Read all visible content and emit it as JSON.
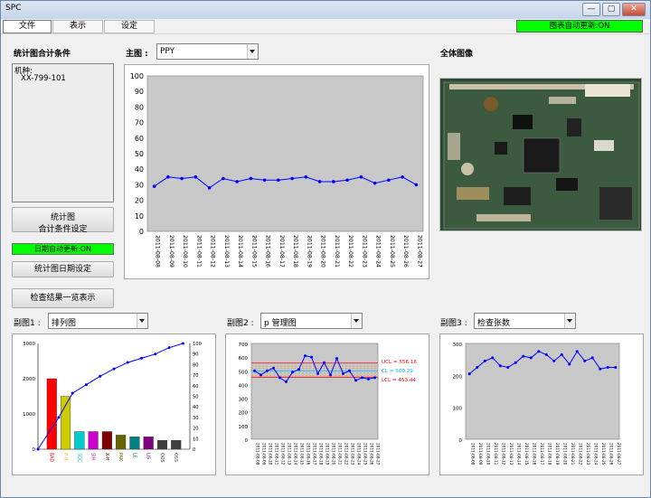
{
  "window": {
    "title": "SPC",
    "minimize": "—",
    "maximize": "▢",
    "close": "✕"
  },
  "menu": {
    "items": [
      "文件",
      "表示",
      "设定"
    ]
  },
  "auto_update_badge": "图表自动更新:ON",
  "left": {
    "section_title": "统计图合计条件",
    "conditions": [
      "机种:",
      "XX-799-101"
    ],
    "btn_stat_line1": "统计图",
    "btn_stat_line2": "合计条件设定",
    "date_auto": "日期自动更新:ON",
    "btn_date": "统计图日期设定",
    "btn_list": "检查结果一览表示"
  },
  "main_chart": {
    "label": "主图 :",
    "select_value": "PPY"
  },
  "overview_title": "全体图像",
  "sub1": {
    "label": "副图1 :",
    "select_value": "排列图"
  },
  "sub2": {
    "label": "副图2 :",
    "select_value": "p 管理图"
  },
  "sub3": {
    "label": "副图3 :",
    "select_value": "检查张数"
  },
  "colors": {
    "line": "#0000ff",
    "plot_bg": "#c8c8c8",
    "ucl": "#ff0000",
    "cl": "#00b4ff",
    "lcl": "#ff0000",
    "badge": "#00ff00"
  },
  "chart_data": [
    {
      "id": "main",
      "type": "line",
      "x": [
        "2011-08-08",
        "2011-08-09",
        "2011-08-10",
        "2011-08-11",
        "2011-08-12",
        "2011-08-13",
        "2011-08-14",
        "2011-08-15",
        "2011-08-16",
        "2011-08-17",
        "2011-08-18",
        "2011-08-19",
        "2011-08-20",
        "2011-08-21",
        "2011-08-22",
        "2011-08-23",
        "2011-08-24",
        "2011-08-25",
        "2011-08-26",
        "2011-08-27"
      ],
      "values": [
        29,
        35,
        34,
        35,
        28,
        34,
        32,
        34,
        33,
        33,
        34,
        35,
        32,
        32,
        33,
        35,
        31,
        33,
        35,
        30
      ],
      "ylim": [
        0,
        100
      ],
      "yticks": [
        0,
        10,
        20,
        30,
        40,
        50,
        60,
        70,
        80,
        90,
        100
      ]
    },
    {
      "id": "pareto",
      "type": "bar",
      "categories": [
        "BAD",
        "P-H",
        "SOC",
        "SIH",
        "X-H",
        "PAK",
        "LE",
        "LIS",
        "OOS",
        "OSS"
      ],
      "values": [
        2000,
        1500,
        500,
        500,
        500,
        400,
        350,
        350,
        250,
        250
      ],
      "bar_colors": [
        "#ff0000",
        "#cccc00",
        "#00cccc",
        "#cc00cc",
        "#800000",
        "#666600",
        "#008080",
        "#800080",
        "#404040",
        "#404040"
      ],
      "cumulative_percent": [
        0,
        30,
        53,
        61,
        69,
        76,
        82,
        86,
        90,
        96,
        100
      ],
      "ylim": [
        0,
        3000
      ],
      "yticks": [
        0,
        1000,
        2000,
        3000
      ],
      "y2ticks": [
        0,
        10,
        20,
        30,
        40,
        50,
        60,
        70,
        80,
        90,
        100
      ]
    },
    {
      "id": "p-chart",
      "type": "line",
      "x": [
        "2011-08-08",
        "2011-08-09",
        "2011-08-10",
        "2011-08-11",
        "2011-08-12",
        "2011-08-13",
        "2011-08-14",
        "2011-08-15",
        "2011-08-16",
        "2011-08-17",
        "2011-08-18",
        "2011-08-19",
        "2011-08-20",
        "2011-08-21",
        "2011-08-22",
        "2011-08-23",
        "2011-08-24",
        "2011-08-25",
        "2011-08-26",
        "2011-08-27"
      ],
      "values": [
        500,
        470,
        500,
        520,
        450,
        420,
        490,
        510,
        610,
        600,
        480,
        560,
        470,
        590,
        480,
        500,
        430,
        450,
        440,
        450
      ],
      "ylim": [
        0,
        700
      ],
      "yticks": [
        0,
        100,
        200,
        300,
        400,
        500,
        600,
        700
      ],
      "limits": [
        {
          "name": "UCL",
          "value": 556.16,
          "label": "UCL = 556.16"
        },
        {
          "name": "CL",
          "value": 500.29,
          "label": "CL = 500.29"
        },
        {
          "name": "LCL",
          "value": 453.44,
          "label": "LCL = 453.44"
        }
      ]
    },
    {
      "id": "inspection-count",
      "type": "line",
      "x": [
        "2011-08-08",
        "2011-08-09",
        "2011-08-10",
        "2011-08-11",
        "2011-08-12",
        "2011-08-13",
        "2011-08-14",
        "2011-08-15",
        "2011-08-16",
        "2011-08-17",
        "2011-08-18",
        "2011-08-19",
        "2011-08-20",
        "2011-08-21",
        "2011-08-22",
        "2011-08-23",
        "2011-08-24",
        "2011-08-25",
        "2011-08-26",
        "2011-08-27"
      ],
      "values": [
        205,
        225,
        245,
        255,
        230,
        225,
        240,
        260,
        255,
        275,
        265,
        245,
        265,
        235,
        275,
        245,
        255,
        220,
        225,
        225
      ],
      "ylim": [
        0,
        300
      ],
      "yticks": [
        0,
        100,
        200,
        300
      ]
    }
  ]
}
